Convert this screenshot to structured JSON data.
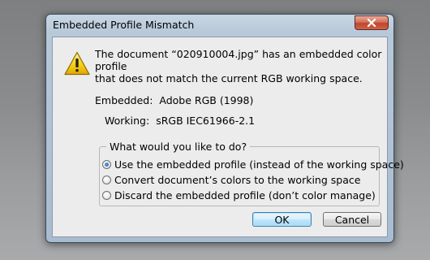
{
  "window": {
    "title": "Embedded Profile Mismatch"
  },
  "icons": {
    "warning": "warning-icon",
    "close": "close-icon"
  },
  "message": {
    "line1": "The document “020910004.jpg” has an embedded color profile",
    "line2": "that does not match the current RGB working space."
  },
  "profiles": {
    "embedded_label": "Embedded:",
    "embedded_value": "Adobe RGB (1998)",
    "working_label": "Working:",
    "working_value": "sRGB IEC61966-2.1"
  },
  "options": {
    "legend": "What would you like to do?",
    "items": [
      {
        "label": "Use the embedded profile (instead of the working space)",
        "selected": true
      },
      {
        "label": "Convert document’s colors to the working space",
        "selected": false
      },
      {
        "label": "Discard the embedded profile (don’t color manage)",
        "selected": false
      }
    ]
  },
  "buttons": {
    "ok": "OK",
    "cancel": "Cancel"
  },
  "colors": {
    "close_button": "#c0442c",
    "radio_selected": "#1c5fb5",
    "warning_yellow": "#f7c900"
  }
}
